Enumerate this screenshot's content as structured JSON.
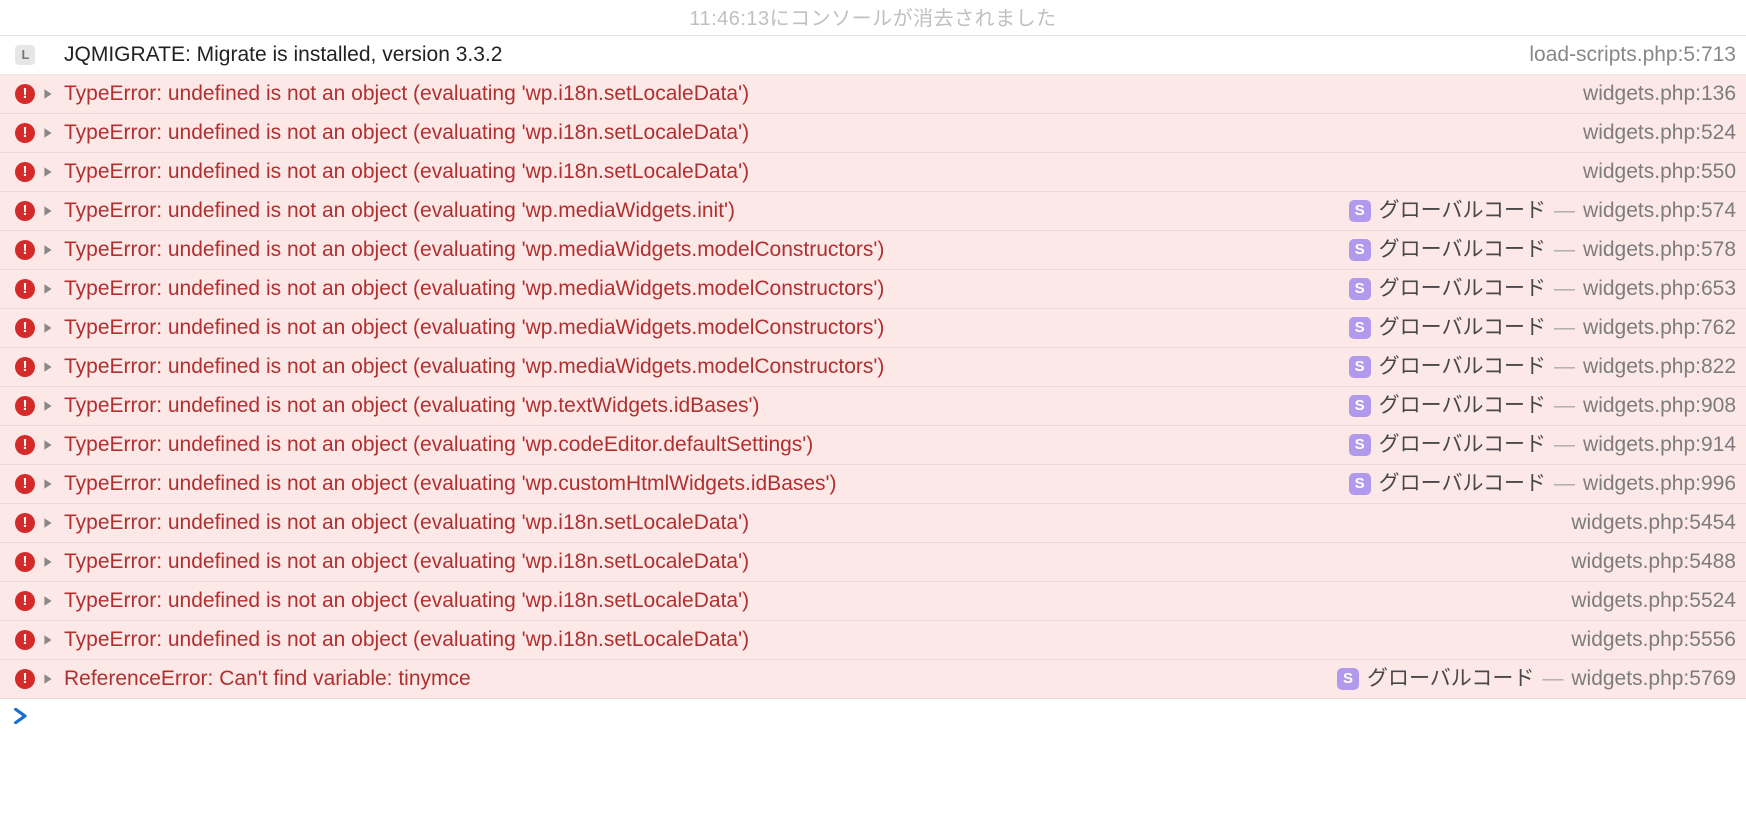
{
  "header_faded": "11:46:13にコンソールが消去されました",
  "scope_label": "グローバルコード",
  "scope_badge": "S",
  "dash": "—",
  "log_badge": "L",
  "rows": [
    {
      "type": "log",
      "msg": "JQMIGRATE: Migrate is installed, version 3.3.2",
      "scope": false,
      "loc": "load-scripts.php:5:713"
    },
    {
      "type": "error",
      "msg": "TypeError: undefined is not an object (evaluating 'wp.i18n.setLocaleData')",
      "scope": false,
      "loc": "widgets.php:136"
    },
    {
      "type": "error",
      "msg": "TypeError: undefined is not an object (evaluating 'wp.i18n.setLocaleData')",
      "scope": false,
      "loc": "widgets.php:524"
    },
    {
      "type": "error",
      "msg": "TypeError: undefined is not an object (evaluating 'wp.i18n.setLocaleData')",
      "scope": false,
      "loc": "widgets.php:550"
    },
    {
      "type": "error",
      "msg": "TypeError: undefined is not an object (evaluating 'wp.mediaWidgets.init')",
      "scope": true,
      "loc": "widgets.php:574"
    },
    {
      "type": "error",
      "msg": "TypeError: undefined is not an object (evaluating 'wp.mediaWidgets.modelConstructors')",
      "scope": true,
      "loc": "widgets.php:578"
    },
    {
      "type": "error",
      "msg": "TypeError: undefined is not an object (evaluating 'wp.mediaWidgets.modelConstructors')",
      "scope": true,
      "loc": "widgets.php:653"
    },
    {
      "type": "error",
      "msg": "TypeError: undefined is not an object (evaluating 'wp.mediaWidgets.modelConstructors')",
      "scope": true,
      "loc": "widgets.php:762"
    },
    {
      "type": "error",
      "msg": "TypeError: undefined is not an object (evaluating 'wp.mediaWidgets.modelConstructors')",
      "scope": true,
      "loc": "widgets.php:822"
    },
    {
      "type": "error",
      "msg": "TypeError: undefined is not an object (evaluating 'wp.textWidgets.idBases')",
      "scope": true,
      "loc": "widgets.php:908"
    },
    {
      "type": "error",
      "msg": "TypeError: undefined is not an object (evaluating 'wp.codeEditor.defaultSettings')",
      "scope": true,
      "loc": "widgets.php:914"
    },
    {
      "type": "error",
      "msg": "TypeError: undefined is not an object (evaluating 'wp.customHtmlWidgets.idBases')",
      "scope": true,
      "loc": "widgets.php:996"
    },
    {
      "type": "error",
      "msg": "TypeError: undefined is not an object (evaluating 'wp.i18n.setLocaleData')",
      "scope": false,
      "loc": "widgets.php:5454"
    },
    {
      "type": "error",
      "msg": "TypeError: undefined is not an object (evaluating 'wp.i18n.setLocaleData')",
      "scope": false,
      "loc": "widgets.php:5488"
    },
    {
      "type": "error",
      "msg": "TypeError: undefined is not an object (evaluating 'wp.i18n.setLocaleData')",
      "scope": false,
      "loc": "widgets.php:5524"
    },
    {
      "type": "error",
      "msg": "TypeError: undefined is not an object (evaluating 'wp.i18n.setLocaleData')",
      "scope": false,
      "loc": "widgets.php:5556"
    },
    {
      "type": "error",
      "msg": "ReferenceError: Can't find variable: tinymce",
      "scope": true,
      "loc": "widgets.php:5769"
    }
  ]
}
